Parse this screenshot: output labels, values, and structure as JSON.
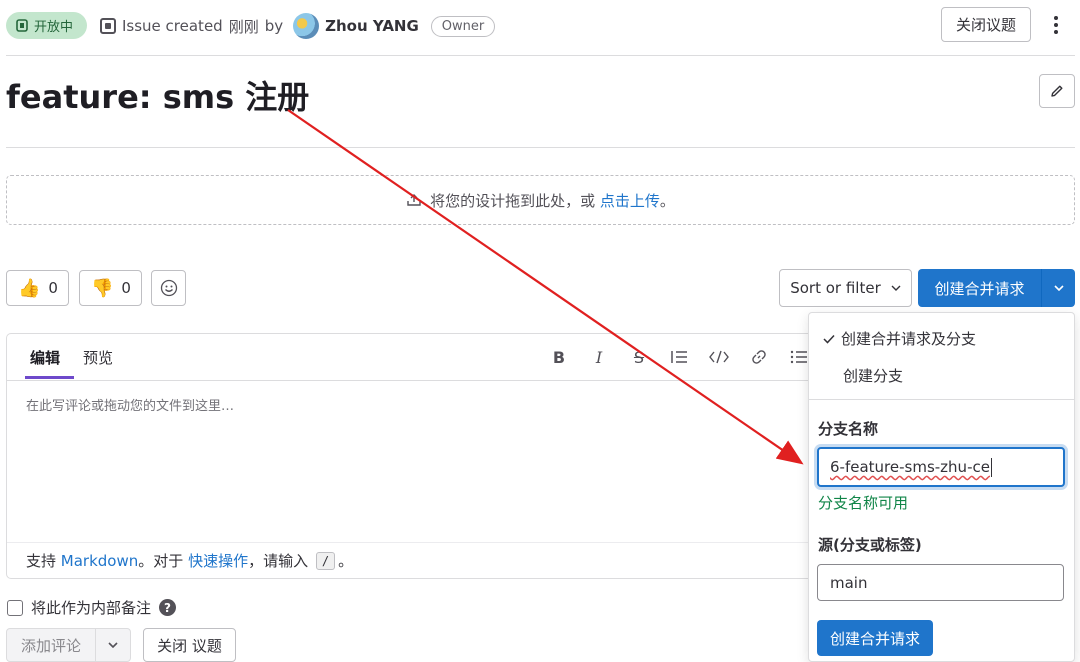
{
  "header": {
    "status": "开放中",
    "meta_prefix": "Issue created",
    "meta_time": "刚刚",
    "meta_by": "by",
    "author": "Zhou YANG",
    "role_badge": "Owner",
    "close_issue_label": "关闭议题"
  },
  "issue": {
    "title": "feature: sms 注册"
  },
  "design_upload": {
    "text": "将您的设计拖到此处，或",
    "link": "点击上传",
    "suffix": "。"
  },
  "reactions": {
    "thumbs_up_count": "0",
    "thumbs_down_count": "0"
  },
  "actions": {
    "sort_filter_label": "Sort or filter",
    "create_mr_label": "创建合并请求"
  },
  "editor": {
    "tabs": [
      "编辑",
      "预览"
    ],
    "toolbar": [
      "bold",
      "italic",
      "strikethrough",
      "bullet-list",
      "code",
      "link",
      "numbered-list"
    ],
    "placeholder": "在此写评论或拖动您的文件到这里…",
    "help_prefix": "支持",
    "help_markdown": "Markdown",
    "help_mid": "。对于",
    "help_quick": "快速操作",
    "help_mid2": "，请输入",
    "help_key": "/",
    "help_suffix": "。"
  },
  "comment": {
    "internal_note_label": "将此作为内部备注",
    "add_comment_label": "添加评论",
    "close_issue_label": "关闭 议题"
  },
  "mr_dropdown": {
    "option_selected": "创建合并请求及分支",
    "option_other": "创建分支",
    "branch_name_label": "分支名称",
    "branch_name_value": "6-feature-sms-zhu-ce",
    "branch_valid_msg": "分支名称可用",
    "source_label": "源(分支或标签)",
    "source_value": "main",
    "create_button_label": "创建合并请求"
  },
  "colors": {
    "primary": "#1f75cb",
    "status_bg": "#c3e6cd",
    "status_text": "#24663b",
    "success": "#108548",
    "annotation_arrow": "#e02020"
  }
}
